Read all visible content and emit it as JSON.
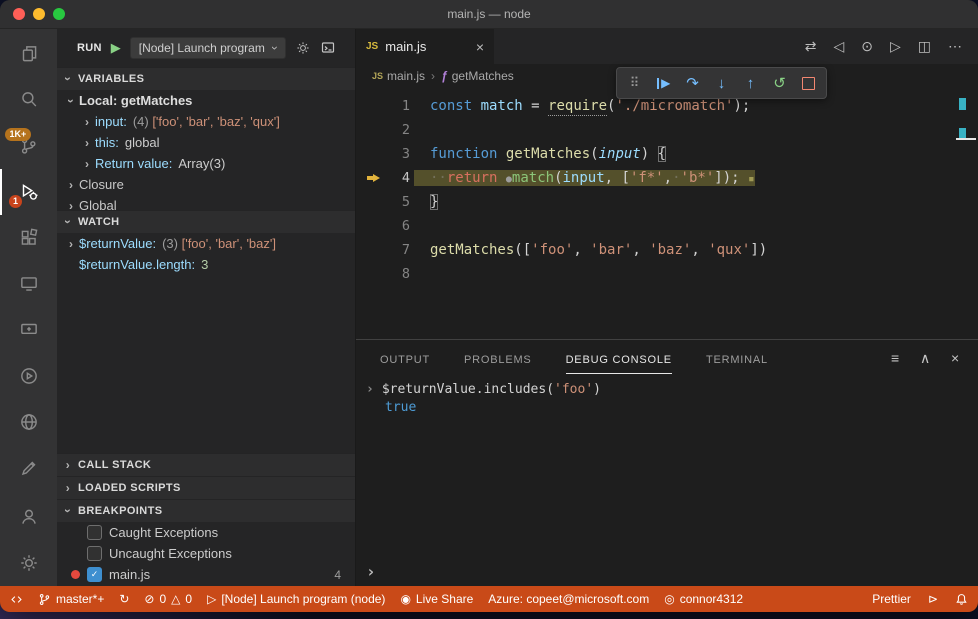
{
  "window": {
    "title": "main.js — node"
  },
  "icons": {
    "twisty": "›",
    "play": "▶",
    "play_outline": "▷",
    "close": "×",
    "more": "⋯",
    "compare": "⇄",
    "prev": "◁",
    "record": "⊙",
    "next": "▷",
    "split": "◫",
    "drag": "⠿",
    "continue_tri": "▶",
    "step_over": "↷",
    "step_into": "↓",
    "step_out": "↑",
    "restart": "↺",
    "filter": "≡",
    "collapse": "∧",
    "error": "⊘",
    "warning": "△",
    "sync": "↻",
    "live": "◉",
    "account_status": "◎",
    "send": "⊳",
    "js_badge": "JS",
    "fn_symbol": "ƒ",
    "prompt": "›"
  },
  "activity_bar": {
    "badges": {
      "scm": "1K+",
      "debug": "1"
    }
  },
  "sidebar": {
    "run_label": "RUN",
    "launch_config": "[Node] Launch program",
    "variables_title": "VARIABLES",
    "watch_title": "WATCH",
    "call_stack_title": "CALL STACK",
    "loaded_scripts_title": "LOADED SCRIPTS",
    "breakpoints_title": "BREAKPOINTS",
    "variables_rows": [
      {
        "twisty": "expanded",
        "indent": 0,
        "name": "Local: getMatches",
        "cls": "scope",
        "parts": []
      },
      {
        "twisty": "collapsed",
        "indent": 1,
        "name": "input:",
        "cls": "varname",
        "parts": [
          [
            "(4) ",
            "muted"
          ],
          [
            "['foo', 'bar', 'baz', 'qux']",
            "str"
          ]
        ]
      },
      {
        "twisty": "collapsed",
        "indent": 1,
        "name": "this:",
        "cls": "varname",
        "parts": [
          [
            "global",
            "val"
          ]
        ]
      },
      {
        "twisty": "collapsed",
        "indent": 1,
        "name": "Return value:",
        "cls": "varname",
        "parts": [
          [
            "Array(3)",
            "val"
          ]
        ]
      },
      {
        "twisty": "collapsed",
        "indent": 0,
        "name": "Closure",
        "cls": "plain",
        "parts": []
      },
      {
        "twisty": "collapsed",
        "indent": 0,
        "name": "Global",
        "cls": "plain",
        "parts": []
      }
    ],
    "watch_rows": [
      {
        "twisty": "collapsed",
        "indent": 0,
        "name": "$returnValue:",
        "cls": "varname",
        "parts": [
          [
            "(3) ",
            "muted"
          ],
          [
            "['foo', 'bar', 'baz']",
            "str"
          ]
        ]
      },
      {
        "twisty": null,
        "indent": 0,
        "name": "$returnValue.length:",
        "cls": "varname",
        "parts": [
          [
            "3",
            "num"
          ]
        ]
      }
    ],
    "breakpoint_rows": [
      {
        "dot": false,
        "checked": false,
        "label": "Caught Exceptions",
        "right": ""
      },
      {
        "dot": false,
        "checked": false,
        "label": "Uncaught Exceptions",
        "right": ""
      },
      {
        "dot": true,
        "checked": true,
        "label": "main.js",
        "right": "4"
      }
    ]
  },
  "editor": {
    "tab_label": "main.js",
    "breadcrumb_file": "main.js",
    "breadcrumb_symbol": "getMatches",
    "code_lines": [
      {
        "no": "1",
        "tokens": [
          [
            "const ",
            "kw"
          ],
          [
            "match",
            "var"
          ],
          [
            " = ",
            "fg"
          ],
          [
            "require",
            "fn hint"
          ],
          [
            "(",
            "fg"
          ],
          [
            "'./micromatch'",
            "str"
          ],
          [
            ");",
            "fg"
          ]
        ]
      },
      {
        "no": "2",
        "tokens": []
      },
      {
        "no": "3",
        "tokens": [
          [
            "function ",
            "kw"
          ],
          [
            "getMatches",
            "fn"
          ],
          [
            "(",
            "fg"
          ],
          [
            "input",
            "param"
          ],
          [
            ") ",
            "fg"
          ],
          [
            "{",
            "fg bracket"
          ]
        ]
      },
      {
        "no": "4",
        "current": true,
        "tokens": [
          [
            "··",
            "ws"
          ],
          [
            "return ",
            "ret"
          ],
          [
            "●",
            "dot"
          ],
          [
            "match",
            "callg"
          ],
          [
            "(",
            "fg"
          ],
          [
            "input",
            "var"
          ],
          [
            ", ",
            "fg"
          ],
          [
            "[",
            "fg"
          ],
          [
            "'f*'",
            "str"
          ],
          [
            ",",
            "fg"
          ],
          [
            "·",
            "ws"
          ],
          [
            "'b*'",
            "str"
          ],
          [
            "]); ",
            "fg"
          ],
          [
            "▪",
            "eol"
          ]
        ]
      },
      {
        "no": "5",
        "tokens": [
          [
            "}",
            "fg bracket"
          ]
        ]
      },
      {
        "no": "6",
        "tokens": []
      },
      {
        "no": "7",
        "tokens": [
          [
            "getMatches",
            "fn"
          ],
          [
            "([",
            "fg"
          ],
          [
            "'foo'",
            "str"
          ],
          [
            ", ",
            "fg"
          ],
          [
            "'bar'",
            "str"
          ],
          [
            ", ",
            "fg"
          ],
          [
            "'baz'",
            "str"
          ],
          [
            ", ",
            "fg"
          ],
          [
            "'qux'",
            "str"
          ],
          [
            "])",
            "fg"
          ]
        ]
      },
      {
        "no": "8",
        "tokens": []
      }
    ]
  },
  "panel": {
    "tabs": [
      "OUTPUT",
      "PROBLEMS",
      "DEBUG CONSOLE",
      "TERMINAL"
    ],
    "active_tab": "DEBUG CONSOLE",
    "console_input_tokens": [
      [
        "$returnValue.includes(",
        "fg"
      ],
      [
        "'foo'",
        "str"
      ],
      [
        ")",
        "fg"
      ]
    ],
    "console_result": "true"
  },
  "status_bar": {
    "branch": "master*+",
    "errors": "0",
    "warnings": "0",
    "launch": "[Node] Launch program (node)",
    "live_share": "Live Share",
    "azure": "Azure: copeet@microsoft.com",
    "account": "connor4312",
    "prettier": "Prettier"
  }
}
